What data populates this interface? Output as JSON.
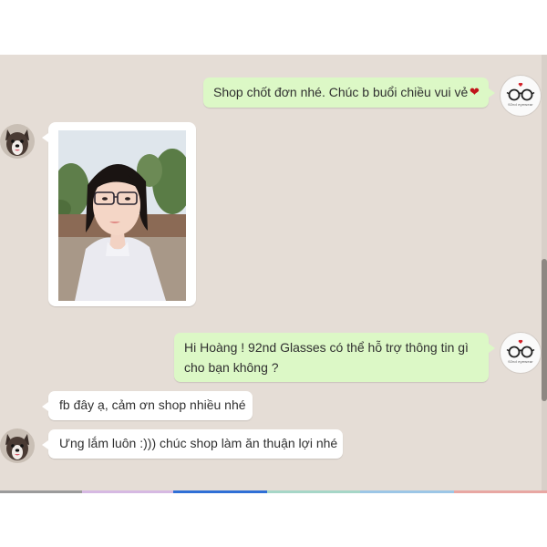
{
  "messages": [
    {
      "id": "m1",
      "direction": "outgoing",
      "text": "Shop chốt đơn nhé. Chúc b buổi chiều vui vẻ",
      "emoji": "heart-emoji"
    },
    {
      "id": "m2",
      "direction": "incoming",
      "type": "image",
      "content": "photo of a girl wearing glasses"
    },
    {
      "id": "m3",
      "direction": "outgoing",
      "line1": "Hi Hoàng ! 92nd Glasses có thể hỗ trợ thông tin gì",
      "line2": "cho bạn không ?"
    },
    {
      "id": "m4",
      "direction": "incoming",
      "text": "fb đây ạ, cảm ơn shop nhiều nhé"
    },
    {
      "id": "m5",
      "direction": "incoming",
      "text": "Ưng lắm luôn :))) chúc shop làm ăn thuận lợi nhé"
    }
  ],
  "shop": {
    "avatar_icon": "glasses-logo-icon",
    "name": "92nd eyewear"
  },
  "user": {
    "avatar_icon": "dog-avatar-icon"
  },
  "colors": {
    "chat_background": "#e5ddd6",
    "outgoing_bubble": "#dcf8c6",
    "incoming_bubble": "#ffffff",
    "heart": "#c0141a"
  }
}
